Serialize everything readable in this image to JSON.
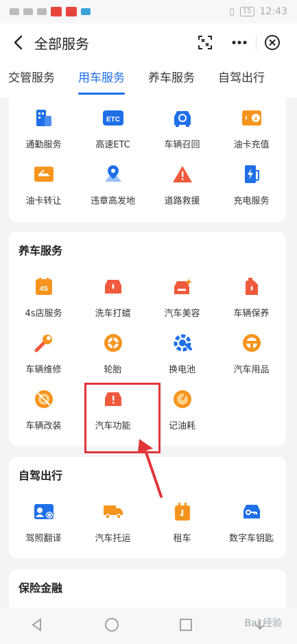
{
  "status": {
    "time": "12:43",
    "battery": "15"
  },
  "header": {
    "title": "全部服务"
  },
  "tabs": [
    {
      "label": "交管服务"
    },
    {
      "label": "用车服务"
    },
    {
      "label": "养车服务"
    },
    {
      "label": "自驾出行"
    }
  ],
  "car_use": {
    "items": [
      {
        "label": "通勤服务",
        "icon": "building-icon"
      },
      {
        "label": "高速ETC",
        "icon": "etc-icon"
      },
      {
        "label": "车辆召回",
        "icon": "car-recall-icon"
      },
      {
        "label": "油卡充值",
        "icon": "fuel-card-icon"
      },
      {
        "label": "油卡转让",
        "icon": "card-transfer-icon"
      },
      {
        "label": "违章高发地",
        "icon": "map-pin-icon"
      },
      {
        "label": "道路救援",
        "icon": "warning-icon"
      },
      {
        "label": "充电服务",
        "icon": "charging-icon"
      }
    ]
  },
  "maintenance": {
    "title": "养车服务",
    "items": [
      {
        "label": "4s店服务",
        "icon": "calendar-4s-icon",
        "badge": "4S"
      },
      {
        "label": "洗车打蜡",
        "icon": "car-wash-icon"
      },
      {
        "label": "汽车美容",
        "icon": "car-beauty-icon"
      },
      {
        "label": "车辆保养",
        "icon": "oil-can-icon"
      },
      {
        "label": "车辆维修",
        "icon": "wrench-icon"
      },
      {
        "label": "轮胎",
        "icon": "tire-icon"
      },
      {
        "label": "换电池",
        "icon": "battery-swap-icon"
      },
      {
        "label": "汽车用品",
        "icon": "steering-wheel-icon"
      },
      {
        "label": "车辆改装",
        "icon": "car-mod-icon"
      },
      {
        "label": "汽车功能",
        "icon": "car-function-icon"
      },
      {
        "label": "记油耗",
        "icon": "fuel-gauge-icon"
      }
    ]
  },
  "selfdrive": {
    "title": "自驾出行",
    "items": [
      {
        "label": "驾照翻译",
        "icon": "license-icon"
      },
      {
        "label": "汽车托运",
        "icon": "truck-icon"
      },
      {
        "label": "租车",
        "icon": "rent-car-icon"
      },
      {
        "label": "数字车钥匙",
        "icon": "car-key-icon"
      }
    ]
  },
  "insurance": {
    "title": "保险金融"
  },
  "watermark": "Bai 经验",
  "colors": {
    "accent": "#1f6fe8",
    "orange": "#f6941d",
    "red": "#ef5a3c",
    "highlight": "#e2353a"
  }
}
